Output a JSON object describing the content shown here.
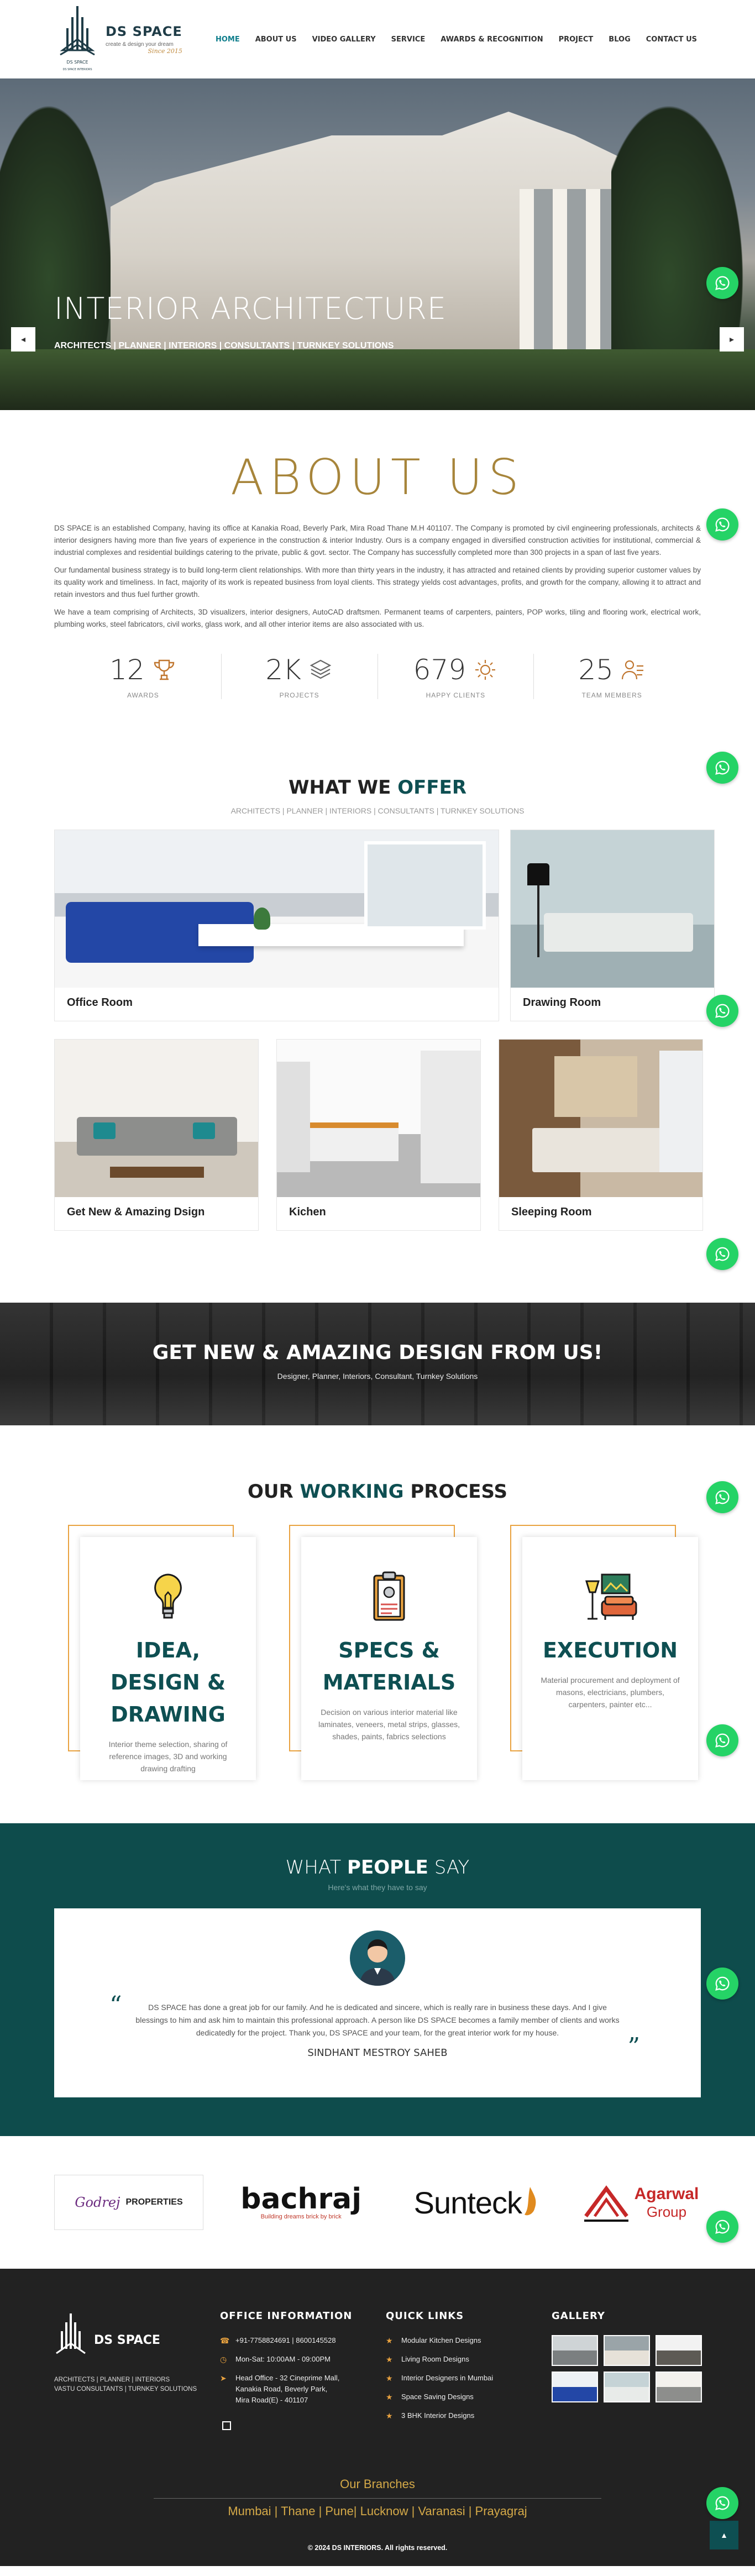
{
  "header": {
    "brand": "DS SPACE",
    "tagline": "create & design your dream",
    "since": "Since 2015",
    "logo_caption": "DS SPACE INTERIORS",
    "nav": [
      "HOME",
      "ABOUT US",
      "VIDEO GALLERY",
      "SERVICE",
      "AWARDS & RECOGNITION",
      "PROJECT",
      "BLOG",
      "CONTACT US"
    ]
  },
  "hero": {
    "title": "INTERIOR ARCHITECTURE",
    "subtitle": "ARCHITECTS | PLANNER | INTERIORS | CONSULTANTS | TURNKEY SOLUTIONS",
    "prev": "◂",
    "next": "▸"
  },
  "about": {
    "title": "ABOUT US",
    "paragraphs": [
      "DS SPACE is an established Company, having its office at Kanakia Road, Beverly Park, Mira Road Thane M.H 401107. The Company is promoted by civil engineering professionals, architects & interior designers having more than five years of experience in the construction & interior Industry. Ours is a company engaged in diversified construction activities for institutional, commercial & industrial complexes and residential buildings catering to the private, public & govt. sector. The Company has successfully completed more than 300 projects in a span of last five years.",
      "Our fundamental business strategy is to build long-term client relationships. With more than thirty years in the industry, it has attracted and retained clients by providing superior customer values by its quality work and timeliness. In fact, majority of its work is repeated business from loyal clients. This strategy yields cost advantages, profits, and growth for the company, allowing it to attract and retain investors and thus fuel further growth.",
      "We have a team comprising of Architects, 3D visualizers, interior designers, AutoCAD draftsmen. Permanent teams of carpenters, painters, POP works, tiling and flooring work, electrical work, plumbing works, steel fabricators, civil works, glass work, and all other interior items are also associated with us."
    ],
    "stats": [
      {
        "num": "12",
        "label": "AWARDS",
        "icon": "trophy-icon"
      },
      {
        "num": "2K",
        "label": "PROJECTS",
        "icon": "layers-icon"
      },
      {
        "num": "679",
        "label": "HAPPY CLIENTS",
        "icon": "sun-icon"
      },
      {
        "num": "25",
        "label": "TEAM MEMBERS",
        "icon": "team-icon"
      }
    ]
  },
  "offer": {
    "title_a": "WHAT WE ",
    "title_b": "OFFER",
    "subtitle": "ARCHITECTS | PLANNER | INTERIORS | CONSULTANTS | TURNKEY SOLUTIONS",
    "cards": [
      "Office Room",
      "Drawing Room",
      "Get New & Amazing Dsign",
      "Kichen",
      "Sleeping Room"
    ]
  },
  "banner": {
    "title": "GET NEW & AMAZING DESIGN FROM US!",
    "subtitle": "Designer, Planner, Interiors, Consultant, Turnkey Solutions"
  },
  "process": {
    "title_a": "OUR ",
    "title_b": "WORKING",
    "title_c": " PROCESS",
    "items": [
      {
        "title": "IDEA, DESIGN & DRAWING",
        "text": "Interior theme selection, sharing of reference images, 3D and working drawing drafting"
      },
      {
        "title": "SPECS & MATERIALS",
        "text": "Decision on various interior material like laminates, veneers, metal strips, glasses, shades, paints, fabrics selections"
      },
      {
        "title": "EXECUTION",
        "text": "Material procurement and deployment of masons, electricians, plumbers, carpenters, painter etc..."
      }
    ]
  },
  "testimonial": {
    "title_a": "WHAT ",
    "title_b": "PEOPLE",
    "title_c": " SAY",
    "subtitle": "Here's what they have to say",
    "quote": "DS SPACE has done a great job for our family. And he is dedicated and sincere, which is really rare in business these days. And I give blessings to him and ask him to maintain this professional approach. A person like DS SPACE becomes a family member of clients and works dedicatedly for the project. Thank you, DS SPACE and your team, for the great interior work for my house.",
    "name": "SINDHANT MESTROY SAHEB",
    "open_q": "“",
    "close_q": "”"
  },
  "clients": {
    "godrej": "Godrej",
    "godrej_suffix": "PROPERTIES",
    "bachraj": "bachraj",
    "bachraj_tag": "Building dreams brick by brick",
    "sunteck": "Sunteck",
    "agarwal": "Agarwal",
    "agarwal2": "Group"
  },
  "footer": {
    "brand": "DS SPACE",
    "brand_line1": "ARCHITECTS | PLANNER | INTERIORS",
    "brand_line2": "VASTU CONSULTANTS | TURNKEY SOLUTIONS",
    "office_title": "OFFICE INFORMATION",
    "phone": "+91-7758824691 | 8600145528",
    "hours": "Mon-Sat: 10:00AM - 09:00PM",
    "address": "Head Office - 32 Cineprime Mall, Kanakia Road, Beverly Park, Mira Road(E) - 401107",
    "links_title": "QUICK LINKS",
    "links": [
      "Modular Kitchen Designs",
      "Living Room Designs",
      "Interior Designers in Mumbai",
      "Space Saving Designs",
      "3 BHK Interior Designs"
    ],
    "gallery_title": "GALLERY",
    "branches_title": "Our Branches",
    "branches": "Mumbai | Thane | Pune| Lucknow | Varanasi | Prayagraj",
    "copyright": "© 2024 DS INTERIORS. All rights reserved.",
    "totop": "▲"
  },
  "colors": {
    "accent": "#0e4f52",
    "gold": "#a7853b",
    "orange": "#e9a23f",
    "whatsapp": "#25d366"
  }
}
